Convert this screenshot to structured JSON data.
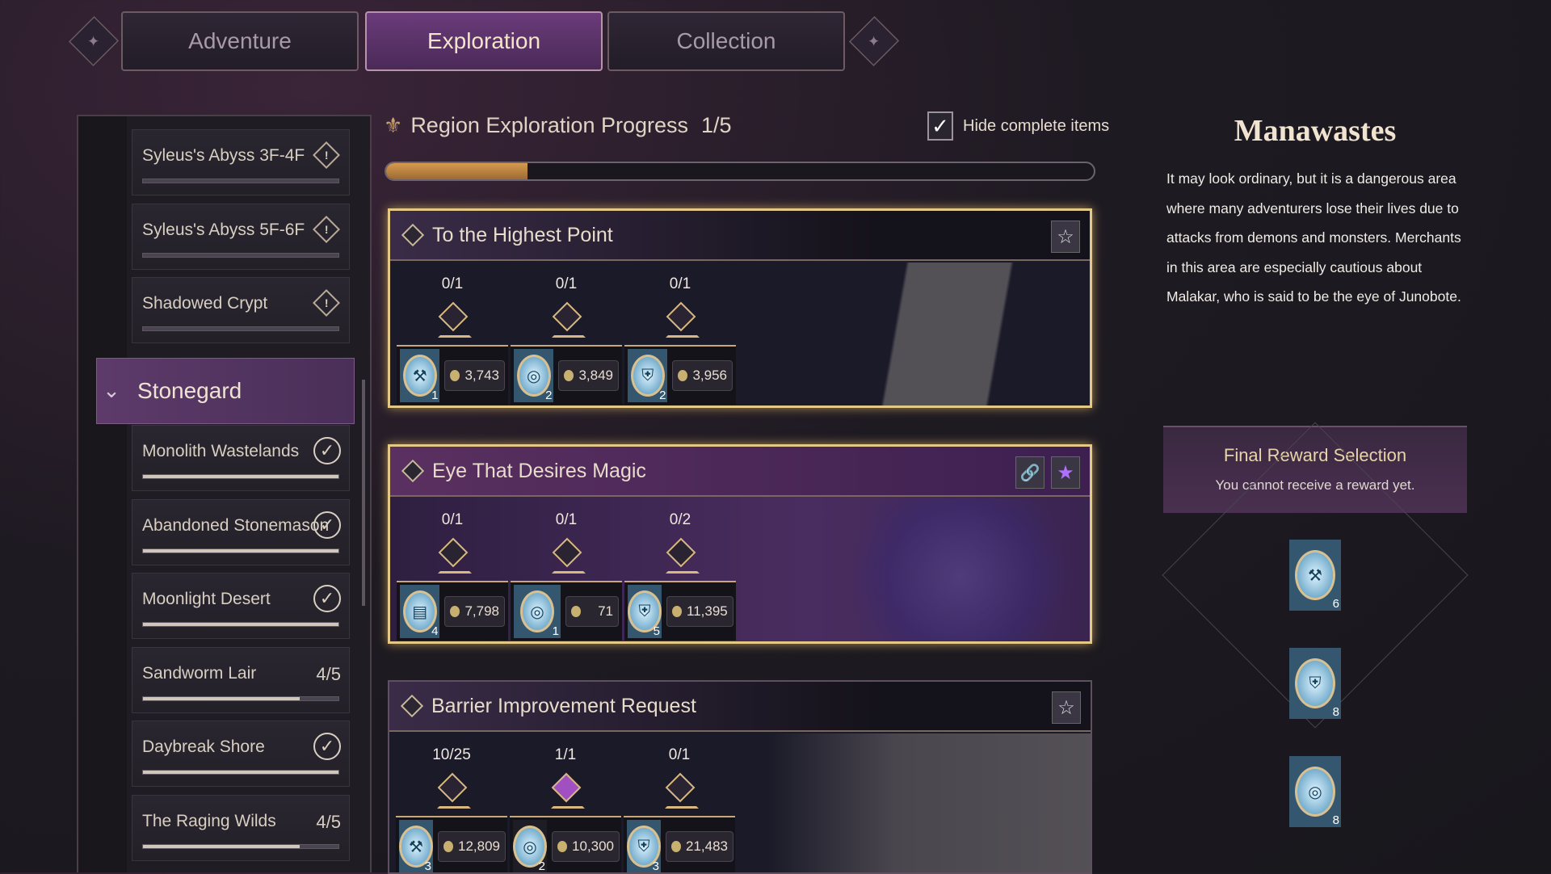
{
  "tabs": [
    {
      "label": "Adventure",
      "active": false
    },
    {
      "label": "Exploration",
      "active": true
    },
    {
      "label": "Collection",
      "active": false
    }
  ],
  "sidebar": {
    "items": [
      {
        "label": "Syleus's Abyss 3F-4F",
        "status": "warning",
        "progress": 0
      },
      {
        "label": "Syleus's Abyss 5F-6F",
        "status": "warning",
        "progress": 0
      },
      {
        "label": "Shadowed Crypt",
        "status": "warning",
        "progress": 0
      },
      {
        "group": "Stonegard",
        "expanded": true
      },
      {
        "label": "Monolith Wastelands",
        "status": "complete",
        "progress": 1
      },
      {
        "label": "Abandoned Stonemason",
        "status": "complete",
        "progress": 1
      },
      {
        "label": "Moonlight Desert",
        "status": "complete",
        "progress": 1
      },
      {
        "label": "Sandworm Lair",
        "status": "4/5",
        "progress": 0.8
      },
      {
        "label": "Daybreak Shore",
        "status": "complete",
        "progress": 1
      },
      {
        "label": "The Raging Wilds",
        "status": "4/5",
        "progress": 0.8
      }
    ]
  },
  "progress": {
    "title": "Region Exploration Progress",
    "value": "1/5",
    "fraction": 0.2,
    "hide_label": "Hide complete items",
    "hide_checked": true
  },
  "cards": [
    {
      "title": "To the Highest Point",
      "selected": true,
      "favorite": false,
      "style": "dark",
      "rewards": [
        {
          "count": "0/1",
          "icon": "pickaxe-icon",
          "qty": "1",
          "price": "3,743",
          "done": false
        },
        {
          "count": "0/1",
          "icon": "ring-icon",
          "qty": "2",
          "price": "3,849",
          "done": false
        },
        {
          "count": "0/1",
          "icon": "armor-icon",
          "qty": "2",
          "price": "3,956",
          "done": false
        }
      ]
    },
    {
      "title": "Eye That Desires Magic",
      "selected": true,
      "favorite": true,
      "linked": true,
      "style": "purple",
      "rewards": [
        {
          "count": "0/1",
          "icon": "book-icon",
          "qty": "4",
          "price": "7,798",
          "done": false
        },
        {
          "count": "0/1",
          "icon": "ring-icon",
          "qty": "1",
          "price": "71",
          "done": false
        },
        {
          "count": "0/2",
          "icon": "armor-icon",
          "qty": "5",
          "price": "11,395",
          "done": false
        }
      ]
    },
    {
      "title": "Barrier Improvement Request",
      "selected": false,
      "favorite": false,
      "style": "dark",
      "rewards": [
        {
          "count": "10/25",
          "icon": "pickaxe-icon",
          "qty": "3",
          "price": "12,809",
          "done": false
        },
        {
          "count": "1/1",
          "icon": "ring-icon",
          "qty": "2",
          "price": "10,300",
          "done": true
        },
        {
          "count": "0/1",
          "icon": "armor-icon",
          "qty": "3",
          "price": "21,483",
          "done": false
        }
      ]
    }
  ],
  "region": {
    "title": "Manawastes",
    "description": "It may look ordinary, but it is a dangerous area where many adventurers lose their lives due to attacks from demons and monsters. Merchants in this area are especially cautious about Malakar, who is said to be the eye of Junobote.",
    "final_title": "Final Reward Selection",
    "final_status": "You cannot receive a reward yet.",
    "final_rewards": [
      {
        "icon": "pickaxe-icon",
        "qty": "6"
      },
      {
        "icon": "armor-icon",
        "qty": "8"
      },
      {
        "icon": "ring-icon",
        "qty": "8"
      }
    ]
  },
  "colors": {
    "accent": "#6b3b7a",
    "gold": "#e4c888",
    "progress": "#d69a50"
  }
}
